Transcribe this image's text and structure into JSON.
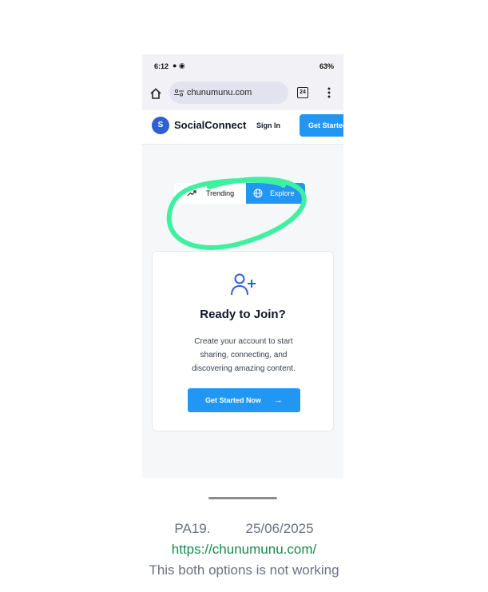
{
  "status_bar": {
    "time": "6:12",
    "right_text": "63%"
  },
  "browser": {
    "url": "chunumunu.com",
    "tab_count": "24"
  },
  "site": {
    "logo_letter": "S",
    "brand": "SocialConnect",
    "sign_in": "Sign In",
    "get_started": "Get Started"
  },
  "tabs": {
    "trending": "Trending",
    "explore": "Explore"
  },
  "card": {
    "title": "Ready to Join?",
    "line1": "Create your account to start",
    "line2": "sharing, connecting, and",
    "line3": "discovering amazing content.",
    "cta": "Get Started Now",
    "cta_arrow": "→"
  },
  "caption": {
    "ref": "PA19.",
    "date": "25/06/2025",
    "url": "https://chunumunu.com/",
    "note": "This both options is not working"
  },
  "colors": {
    "accent": "#2196f3",
    "logo": "#2f5fd3",
    "annotation": "#3ef0a0",
    "link": "#188a4e"
  },
  "icons": [
    "home-icon",
    "site-settings-icon",
    "tabs-icon",
    "more-menu-icon",
    "trending-icon",
    "globe-icon",
    "user-plus-icon",
    "arrow-right-icon"
  ]
}
